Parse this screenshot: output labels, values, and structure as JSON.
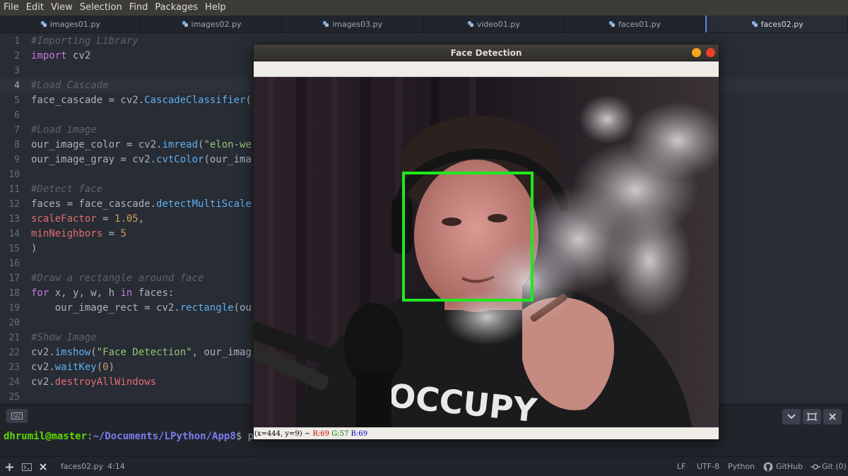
{
  "menu": [
    "File",
    "Edit",
    "View",
    "Selection",
    "Find",
    "Packages",
    "Help"
  ],
  "tabs": [
    {
      "label": "images01.py",
      "active": false
    },
    {
      "label": "images02.py",
      "active": false
    },
    {
      "label": "images03.py",
      "active": false
    },
    {
      "label": "video01.py",
      "active": false
    },
    {
      "label": "faces01.py",
      "active": false
    },
    {
      "label": "faces02.py",
      "active": true
    }
  ],
  "editor": {
    "cursor_line": 4,
    "lines": [
      {
        "n": "1",
        "parts": [
          {
            "t": "#Importing Library",
            "c": "com"
          }
        ]
      },
      {
        "n": "2",
        "parts": [
          {
            "t": "import",
            "c": "kw"
          },
          {
            "t": " cv2",
            "c": "pl"
          }
        ]
      },
      {
        "n": "3",
        "parts": []
      },
      {
        "n": "4",
        "parts": [
          {
            "t": "#Load Cascade",
            "c": "com"
          }
        ]
      },
      {
        "n": "5",
        "parts": [
          {
            "t": "face_cascade = cv2.",
            "c": "pl"
          },
          {
            "t": "CascadeClassifier",
            "c": "fn"
          },
          {
            "t": "(",
            "c": "pl"
          }
        ]
      },
      {
        "n": "6",
        "parts": []
      },
      {
        "n": "7",
        "parts": [
          {
            "t": "#Load image",
            "c": "com"
          }
        ]
      },
      {
        "n": "8",
        "parts": [
          {
            "t": "our_image_color = cv2.",
            "c": "pl"
          },
          {
            "t": "imread",
            "c": "fn"
          },
          {
            "t": "(",
            "c": "pl"
          },
          {
            "t": "\"elon-we",
            "c": "str"
          }
        ]
      },
      {
        "n": "9",
        "parts": [
          {
            "t": "our_image_gray = cv2.",
            "c": "pl"
          },
          {
            "t": "cvtColor",
            "c": "fn"
          },
          {
            "t": "(our_ima",
            "c": "pl"
          }
        ]
      },
      {
        "n": "10",
        "parts": []
      },
      {
        "n": "11",
        "parts": [
          {
            "t": "#Detect face",
            "c": "com"
          }
        ]
      },
      {
        "n": "12",
        "parts": [
          {
            "t": "faces = face_cascade.",
            "c": "pl"
          },
          {
            "t": "detectMultiScale",
            "c": "fn"
          }
        ]
      },
      {
        "n": "13",
        "parts": [
          {
            "t": "scaleFactor",
            "c": "var"
          },
          {
            "t": " = ",
            "c": "pl"
          },
          {
            "t": "1.05",
            "c": "num"
          },
          {
            "t": ",",
            "c": "pl"
          }
        ]
      },
      {
        "n": "14",
        "parts": [
          {
            "t": "minNeighbors",
            "c": "var"
          },
          {
            "t": " = ",
            "c": "pl"
          },
          {
            "t": "5",
            "c": "num"
          }
        ]
      },
      {
        "n": "15",
        "parts": [
          {
            "t": ")",
            "c": "pl"
          }
        ]
      },
      {
        "n": "16",
        "parts": []
      },
      {
        "n": "17",
        "parts": [
          {
            "t": "#Draw a rectangle around face",
            "c": "com"
          }
        ]
      },
      {
        "n": "18",
        "parts": [
          {
            "t": "for",
            "c": "kw"
          },
          {
            "t": " x, y, w, h ",
            "c": "pl"
          },
          {
            "t": "in",
            "c": "kw"
          },
          {
            "t": " faces:",
            "c": "pl"
          }
        ]
      },
      {
        "n": "19",
        "parts": [
          {
            "t": "    our_image_rect = cv2.",
            "c": "pl"
          },
          {
            "t": "rectangle",
            "c": "fn"
          },
          {
            "t": "(ou",
            "c": "pl"
          }
        ]
      },
      {
        "n": "20",
        "parts": []
      },
      {
        "n": "21",
        "parts": [
          {
            "t": "#Show Image",
            "c": "com"
          }
        ]
      },
      {
        "n": "22",
        "parts": [
          {
            "t": "cv2.",
            "c": "pl"
          },
          {
            "t": "imshow",
            "c": "fn"
          },
          {
            "t": "(",
            "c": "pl"
          },
          {
            "t": "\"Face Detection\"",
            "c": "str"
          },
          {
            "t": ", our_imag",
            "c": "pl"
          }
        ]
      },
      {
        "n": "23",
        "parts": [
          {
            "t": "cv2.",
            "c": "pl"
          },
          {
            "t": "waitKey",
            "c": "fn"
          },
          {
            "t": "(",
            "c": "pl"
          },
          {
            "t": "0",
            "c": "num"
          },
          {
            "t": ")",
            "c": "pl"
          }
        ]
      },
      {
        "n": "24",
        "parts": [
          {
            "t": "cv2.",
            "c": "pl"
          },
          {
            "t": "destroyAllWindows",
            "c": "var"
          }
        ]
      },
      {
        "n": "25",
        "parts": []
      }
    ]
  },
  "terminal": {
    "user": "dhrumil@master",
    "colon": ":",
    "path": "~/Documents/LPython/App8",
    "dollar": "$",
    "command_tail": " p"
  },
  "statusbar": {
    "filename": "faces02.py",
    "position": "4:14",
    "line_ending": "LF",
    "encoding": "UTF-8",
    "grammar": "Python",
    "github": "GitHub",
    "git": "Git (0)"
  },
  "window": {
    "title": "Face Detection",
    "status_coords": "(x=444, y=9) ~ ",
    "status_r": "R:69",
    "status_g": "G:57",
    "status_b": "B:69"
  },
  "colors": {
    "detection_box": "#1fe81f",
    "accent": "#568af2"
  }
}
